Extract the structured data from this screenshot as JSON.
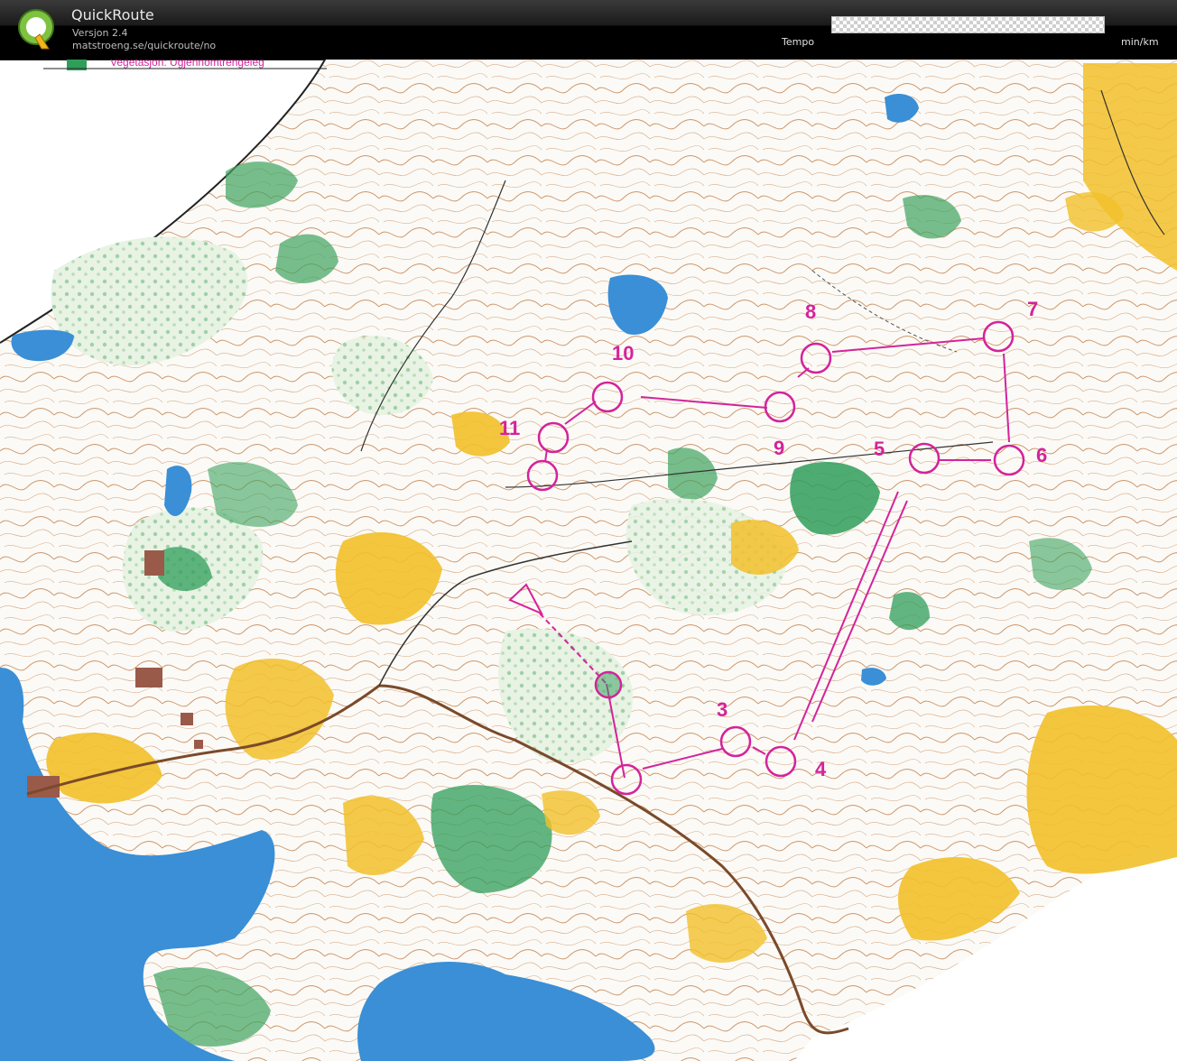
{
  "app": {
    "title": "QuickRoute",
    "version": "Versjon 2.4",
    "url": "matstroeng.se/quickroute/no",
    "logo_letter": "Q"
  },
  "tempo": {
    "label": "Tempo",
    "unit": "min/km"
  },
  "map": {
    "legend_text": "Vegetasjon: Ugjennomtrengeleg",
    "course_color": "#d4239b",
    "controls": [
      {
        "label": "3"
      },
      {
        "label": "4"
      },
      {
        "label": "5"
      },
      {
        "label": "6"
      },
      {
        "label": "7"
      },
      {
        "label": "8"
      },
      {
        "label": "9"
      },
      {
        "label": "10"
      },
      {
        "label": "11"
      }
    ],
    "colors": {
      "water": "#3a8fd6",
      "open_land": "#f2c02a",
      "forest_green": "#2f9e5a",
      "contour": "#b86a3a",
      "road": "#7a4a2a",
      "paper": "#fbfaf6"
    }
  }
}
